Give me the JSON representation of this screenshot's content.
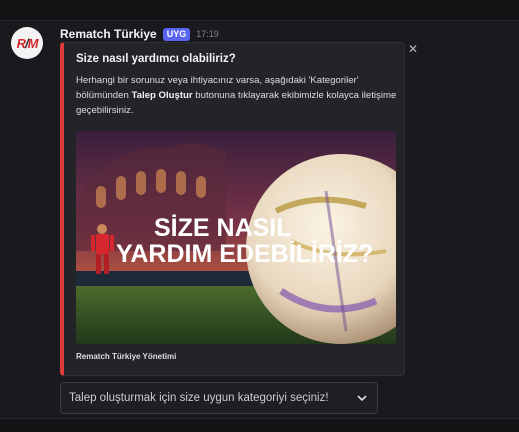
{
  "message": {
    "author": "Rematch Türkiye",
    "badge": "UYG",
    "time": "17:19",
    "avatar_text": {
      "r": "R",
      "slash": "/",
      "m": "M"
    }
  },
  "embed": {
    "title": "Size nasıl yardımcı olabiliriz?",
    "desc_part1": "Herhangi bir sorunuz veya ihtiyacınız varsa, aşağıdaki 'Kategoriler' bölümünden ",
    "desc_bold": "Talep Oluştur",
    "desc_part2": " butonuna tıklayarak ekibimizle kolayca iletişime geçebilirsiniz.",
    "image_line1": "SİZE NASIL",
    "image_line2": "YARDIM EDEBİLİRİZ?",
    "footer": "Rematch Türkiye Yönetimi",
    "accent_color": "#e03b3b"
  },
  "select": {
    "placeholder": "Talep oluşturmak için size uygun kategoriyi seçiniz!"
  },
  "icons": {
    "close": "close-icon",
    "dropdown": "chevron-down-icon"
  }
}
